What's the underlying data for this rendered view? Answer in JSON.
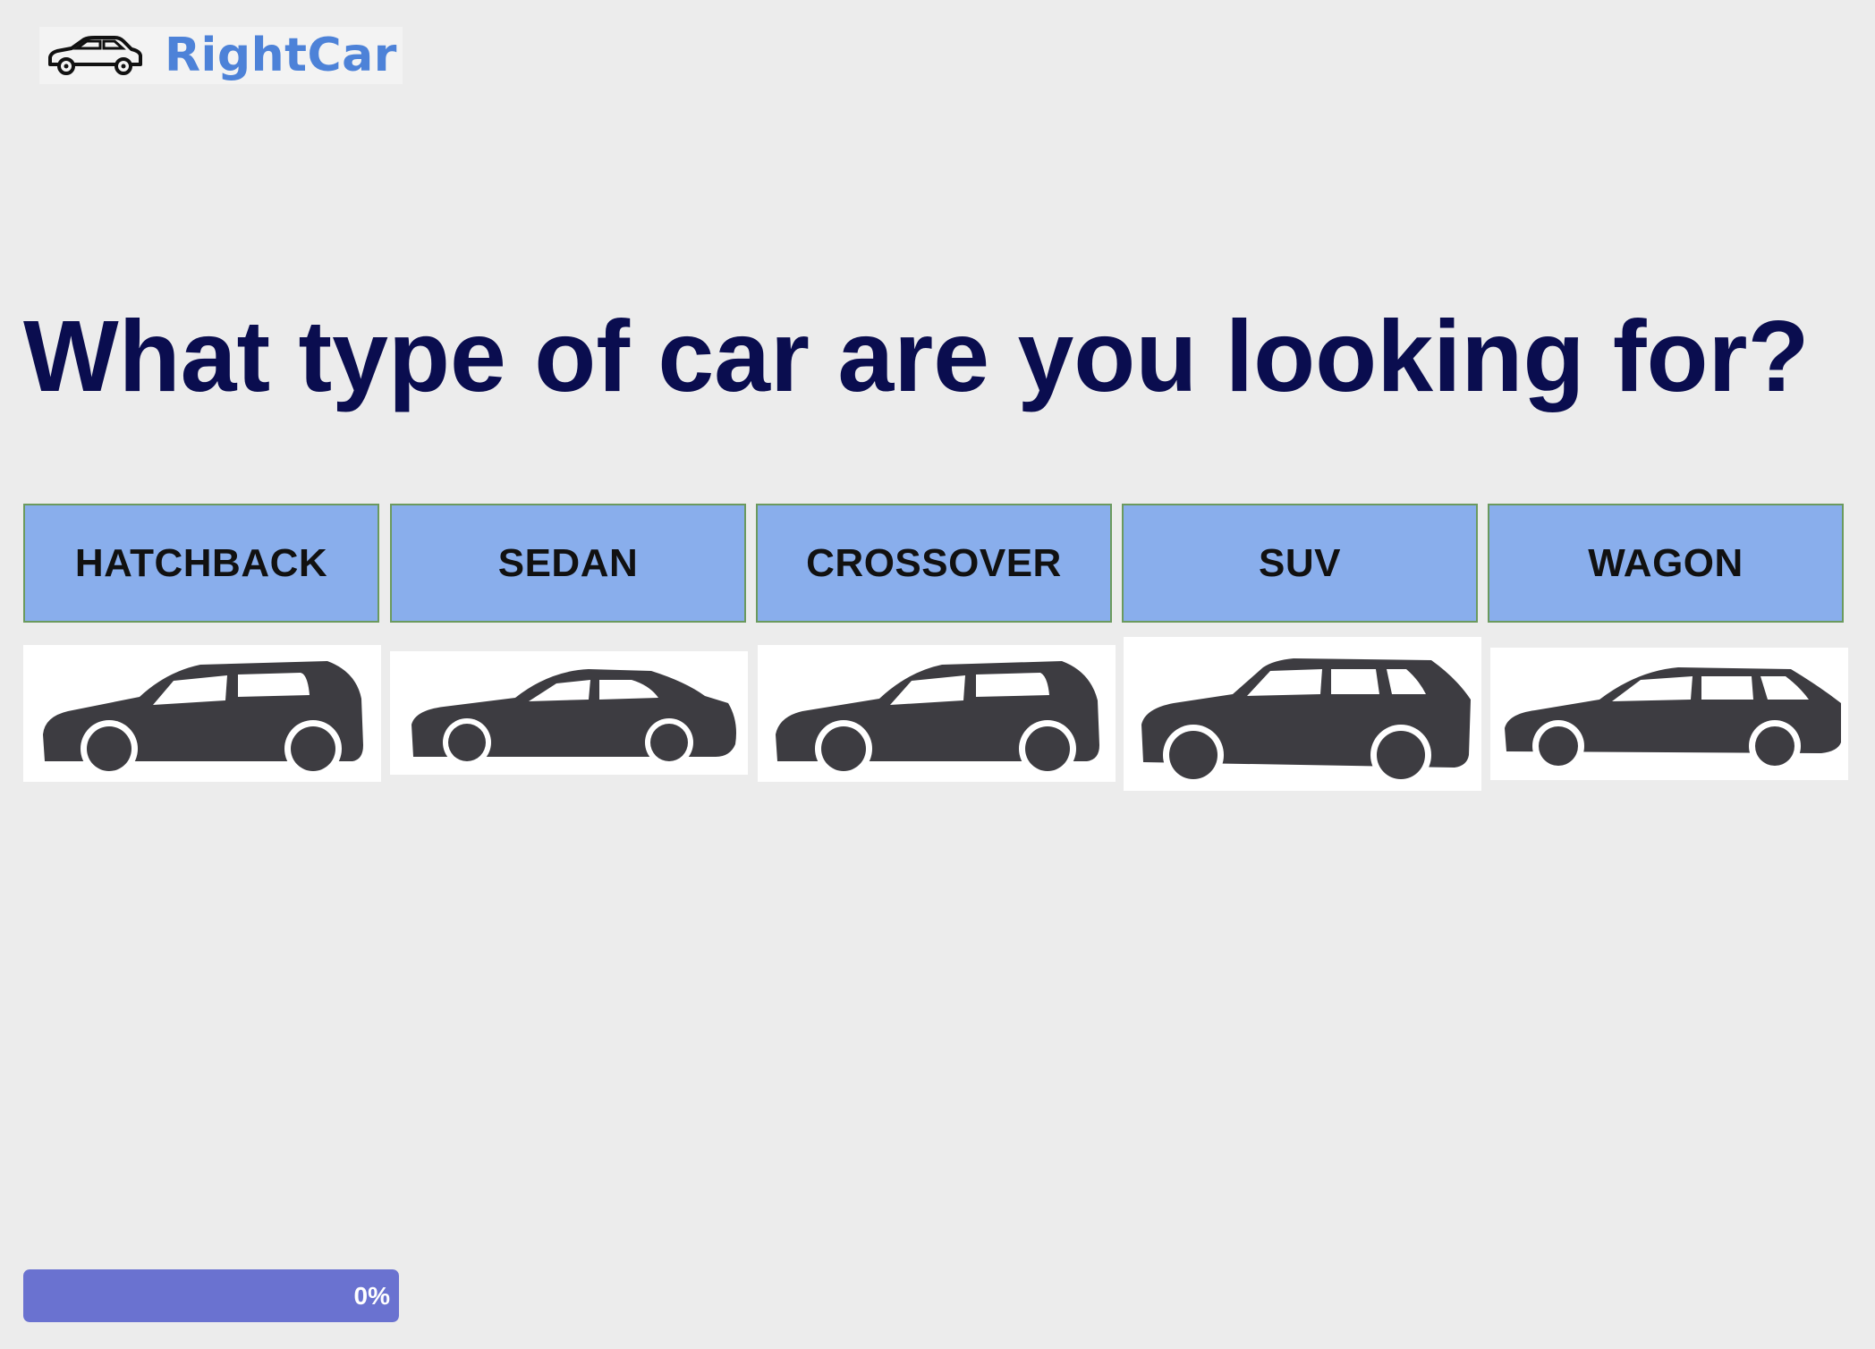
{
  "brand": {
    "name": "RightCar",
    "icon": "car-outline-icon",
    "color": "#4d82d8"
  },
  "question": {
    "title": "What type of car are you looking for?",
    "color": "#0a0d4f"
  },
  "options": [
    {
      "label": "HATCHBACK",
      "icon": "hatchback-car-icon"
    },
    {
      "label": "SEDAN",
      "icon": "sedan-car-icon"
    },
    {
      "label": "CROSSOVER",
      "icon": "crossover-car-icon"
    },
    {
      "label": "SUV",
      "icon": "suv-car-icon"
    },
    {
      "label": "WAGON",
      "icon": "wagon-car-icon"
    }
  ],
  "progress": {
    "value": 0,
    "label": "0%",
    "color": "#6a72d0"
  },
  "colors": {
    "button_bg": "#89aeec",
    "button_border": "#6b9a5e",
    "page_bg": "#ececec",
    "silhouette": "#3d3c41"
  }
}
